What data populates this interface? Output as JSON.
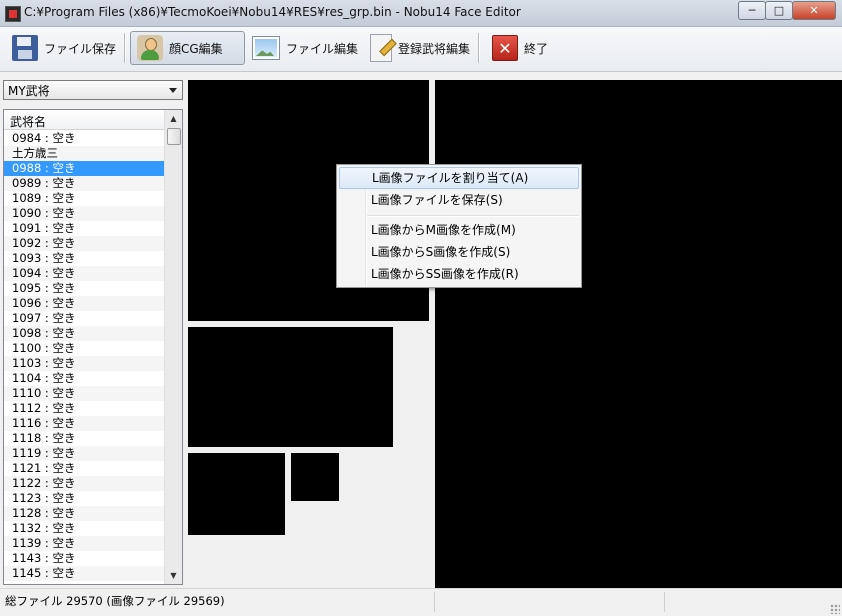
{
  "window": {
    "title": "C:¥Program Files (x86)¥TecmoKoei¥Nobu14¥RES¥res_grp.bin - Nobu14 Face Editor",
    "minimize": "─",
    "maximize": "□",
    "close": "✕"
  },
  "toolbar": {
    "save_label": "ファイル保存",
    "face_edit_label": "顔CG編集",
    "file_edit_label": "ファイル編集",
    "registered_edit_label": "登録武将編集",
    "exit_label": "終了",
    "active": "face_edit"
  },
  "sidebar": {
    "combo_value": "MY武将",
    "list_header": "武将名",
    "selected_index": 2,
    "items": [
      "0984 : 空き",
      "土方歳三",
      "0988 : 空き",
      "0989 : 空き",
      "1089 : 空き",
      "1090 : 空き",
      "1091 : 空き",
      "1092 : 空き",
      "1093 : 空き",
      "1094 : 空き",
      "1095 : 空き",
      "1096 : 空き",
      "1097 : 空き",
      "1098 : 空き",
      "1100 : 空き",
      "1103 : 空き",
      "1104 : 空き",
      "1110 : 空き",
      "1112 : 空き",
      "1116 : 空き",
      "1118 : 空き",
      "1119 : 空き",
      "1121 : 空き",
      "1122 : 空き",
      "1123 : 空き",
      "1128 : 空き",
      "1132 : 空き",
      "1139 : 空き",
      "1143 : 空き",
      "1145 : 空き"
    ]
  },
  "context_menu": {
    "items": [
      {
        "label": "L画像ファイルを割り当て(A)"
      },
      {
        "label": "L画像ファイルを保存(S)"
      },
      {
        "label": "L画像からM画像を作成(M)"
      },
      {
        "label": "L画像からS画像を作成(S)"
      },
      {
        "label": "L画像からSS画像を作成(R)"
      }
    ],
    "hover_index": 0
  },
  "status": {
    "text": "総ファイル 29570 (画像ファイル 29569)"
  },
  "colors": {
    "selection": "#3399ff",
    "canvas_image": "#000000"
  }
}
